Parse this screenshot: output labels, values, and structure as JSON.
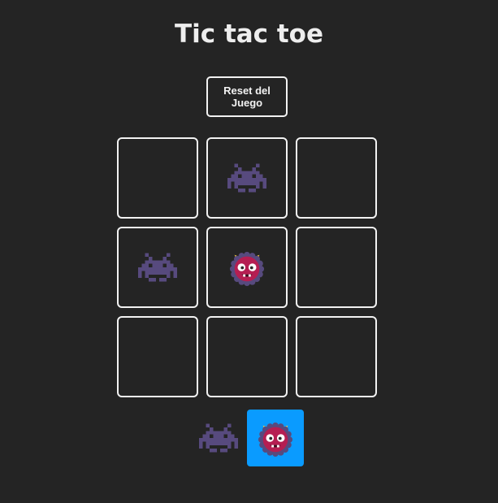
{
  "title": "Tic tac toe",
  "reset_label": "Reset del Juego",
  "board": [
    "",
    "X",
    "",
    "X",
    "O",
    "",
    "",
    "",
    ""
  ],
  "turn_indicator": {
    "players": [
      "X",
      "O"
    ],
    "active": "O",
    "active_color": "#0a9bff"
  },
  "icons": {
    "X": "alien-monster-icon",
    "O": "ogre-icon"
  },
  "colors": {
    "background": "#242424",
    "border": "#f2f2f2",
    "alien": "#574a7e",
    "ogre_face": "#b51e52",
    "ogre_fringe": "#574a7e",
    "ogre_horns": "#f5c542"
  }
}
